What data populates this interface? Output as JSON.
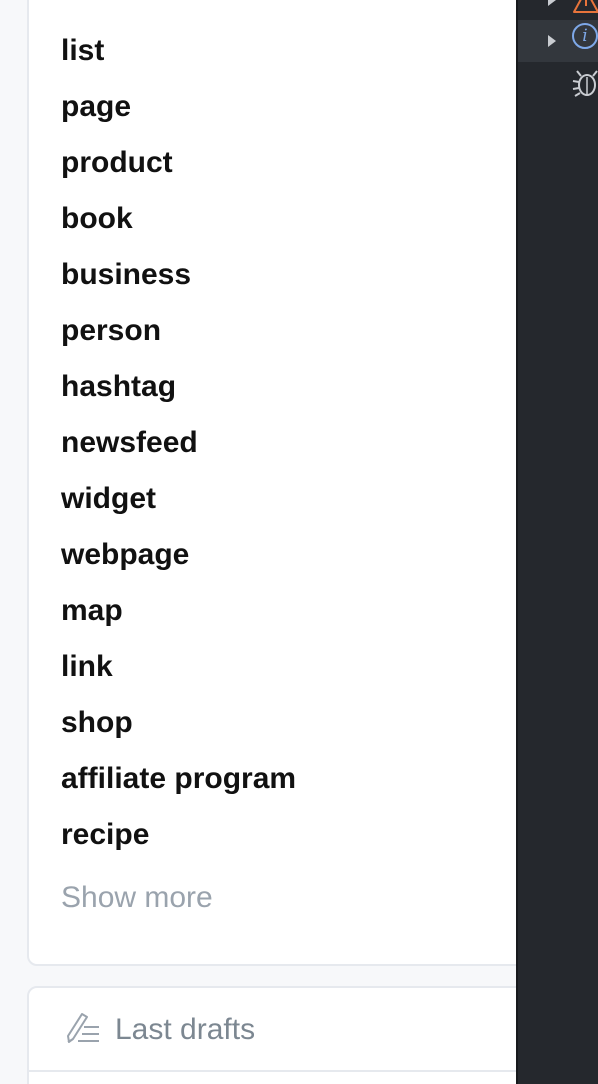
{
  "tags": {
    "items": [
      "list",
      "page",
      "product",
      "book",
      "business",
      "person",
      "hashtag",
      "newsfeed",
      "widget",
      "webpage",
      "map",
      "link",
      "shop",
      "affiliate program",
      "recipe"
    ],
    "show_more_label": "Show more"
  },
  "drafts": {
    "label": "Last drafts",
    "icon": "pen-lines-icon"
  },
  "devtools": {
    "icons": [
      "warning-icon",
      "info-icon",
      "bug-icon"
    ],
    "info_glyph": "i"
  },
  "colors": {
    "tag_text": "#111111",
    "muted_text": "#9aa3ad",
    "devtools_bg": "#25282d",
    "warning": "#e8743b",
    "info": "#7ea8e8"
  }
}
